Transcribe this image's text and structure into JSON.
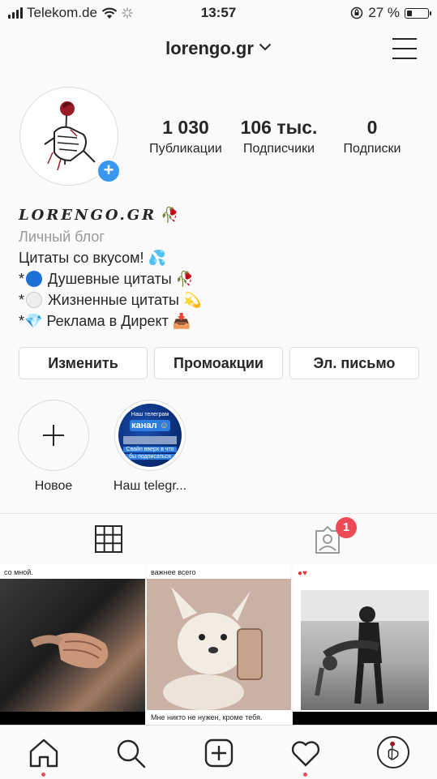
{
  "status_bar": {
    "carrier": "Telekom.de",
    "time": "13:57",
    "battery": "27 %"
  },
  "header": {
    "username": "lorengo.gr"
  },
  "stats": [
    {
      "value": "1 030",
      "label": "Публикации"
    },
    {
      "value": "106 тыс.",
      "label": "Подписчики"
    },
    {
      "value": "0",
      "label": "Подписки"
    }
  ],
  "bio": {
    "name": "LORENGO.GR",
    "category": "Личный блог",
    "lines": [
      "Цитаты со вкусом!",
      "*",
      "Душевные цитаты",
      "*",
      "Жизненные цитаты",
      "*",
      "Реклама в Директ"
    ]
  },
  "buttons": {
    "edit": "Изменить",
    "promo": "Промоакции",
    "email": "Эл. письмо"
  },
  "stories": [
    {
      "label": "Новое"
    },
    {
      "label": "Наш telegr..."
    }
  ],
  "story_preview": {
    "line1": "Наш телеграм",
    "line2": "канал",
    "line3": "Свайп вверх в что",
    "line4": "бы подписаться"
  },
  "tabs": {
    "tagged_badge": "1"
  },
  "posts": [
    {
      "caption": "со мной."
    },
    {
      "caption": "важнее всего",
      "caption_bottom": "Мне никто не нужен, кроме тебя."
    },
    {
      "caption": ""
    }
  ],
  "colors": {
    "accent": "#3897f0",
    "badge": "#ed4956"
  }
}
